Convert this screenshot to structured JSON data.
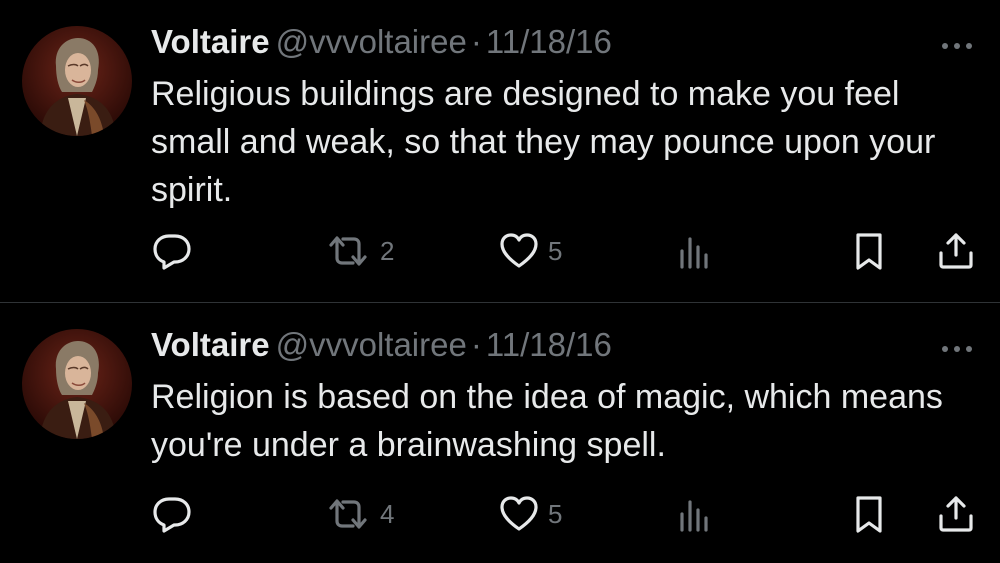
{
  "colors": {
    "background": "#000000",
    "text_primary": "#e7e9ea",
    "text_secondary": "#71767b",
    "divider": "#2f3336"
  },
  "tweets": [
    {
      "author_name": "Voltaire",
      "handle": "@vvvoltairee",
      "separator": "·",
      "date": "11/18/16",
      "text": "Religious buildings are designed to make you feel small and weak, so that they may pounce upon your spirit.",
      "retweets": "2",
      "likes": "5",
      "avatar_icon": "voltaire-portrait",
      "icons": [
        "more-icon",
        "reply-icon",
        "retweet-icon",
        "like-icon",
        "views-icon",
        "bookmark-icon",
        "share-icon"
      ]
    },
    {
      "author_name": "Voltaire",
      "handle": "@vvvoltairee",
      "separator": "·",
      "date": "11/18/16",
      "text": "Religion is based on the idea of magic, which means you're under a brainwashing spell.",
      "retweets": "4",
      "likes": "5",
      "avatar_icon": "voltaire-portrait",
      "icons": [
        "more-icon",
        "reply-icon",
        "retweet-icon",
        "like-icon",
        "views-icon",
        "bookmark-icon",
        "share-icon"
      ]
    }
  ]
}
